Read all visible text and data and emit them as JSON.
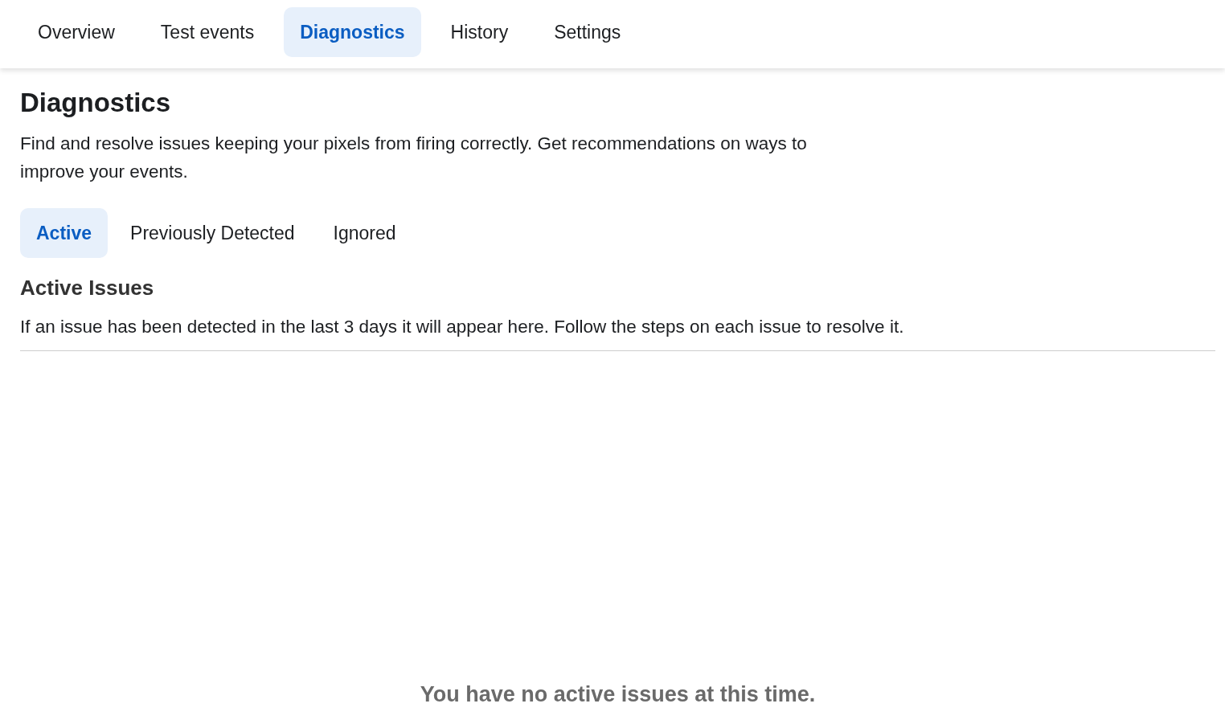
{
  "tabs": [
    {
      "label": "Overview",
      "selected": false
    },
    {
      "label": "Test events",
      "selected": false
    },
    {
      "label": "Diagnostics",
      "selected": true
    },
    {
      "label": "History",
      "selected": false
    },
    {
      "label": "Settings",
      "selected": false
    }
  ],
  "page": {
    "title": "Diagnostics",
    "description": "Find and resolve issues keeping your pixels from firing correctly. Get recommendations on ways to improve your events."
  },
  "subtabs": [
    {
      "label": "Active",
      "selected": true
    },
    {
      "label": "Previously Detected",
      "selected": false
    },
    {
      "label": "Ignored",
      "selected": false
    }
  ],
  "section": {
    "title": "Active Issues",
    "description": "If an issue has been detected in the last 3 days it will appear here. Follow the steps on each issue to resolve it.",
    "empty_message": "You have no active issues at this time."
  }
}
